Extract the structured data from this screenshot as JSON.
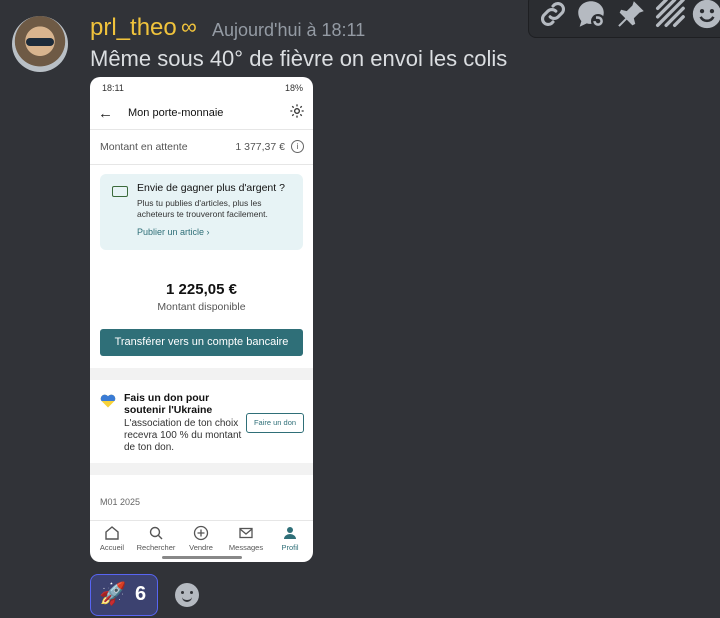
{
  "message": {
    "username": "prl_theo",
    "badge_icon": "infinity-icon",
    "timestamp": "Aujourd'hui à 18:11",
    "text": "Même sous 40° de fièvre on envoi les colis"
  },
  "toolbar": {
    "icons": [
      "link-icon",
      "reply-thread-icon",
      "pin-icon",
      "app-icon",
      "emoji-icon"
    ]
  },
  "phone": {
    "status_time": "18:11",
    "status_right": "18%",
    "header_title": "Mon porte-monnaie",
    "pending_label": "Montant en attente",
    "pending_amount": "1 377,37 €",
    "promo": {
      "title": "Envie de gagner plus d'argent ?",
      "body": "Plus tu publies d'articles, plus les acheteurs te trouveront facilement.",
      "link": "Publier un article"
    },
    "balance_amount": "1 225,05 €",
    "balance_label": "Montant disponible",
    "transfer_button": "Transférer vers un compte bancaire",
    "donation": {
      "title": "Fais un don pour soutenir l'Ukraine",
      "body": "L'association de ton choix recevra 100 % du montant de ton don.",
      "button": "Faire un don"
    },
    "month": "M01 2025",
    "nav": {
      "home": "Accueil",
      "search": "Rechercher",
      "sell": "Vendre",
      "messages": "Messages",
      "profile": "Profil"
    }
  },
  "reaction": {
    "emoji": "🚀",
    "count": "6"
  },
  "colors": {
    "username": "#f0c33c",
    "accent": "#2f6f78",
    "background": "#313338"
  }
}
